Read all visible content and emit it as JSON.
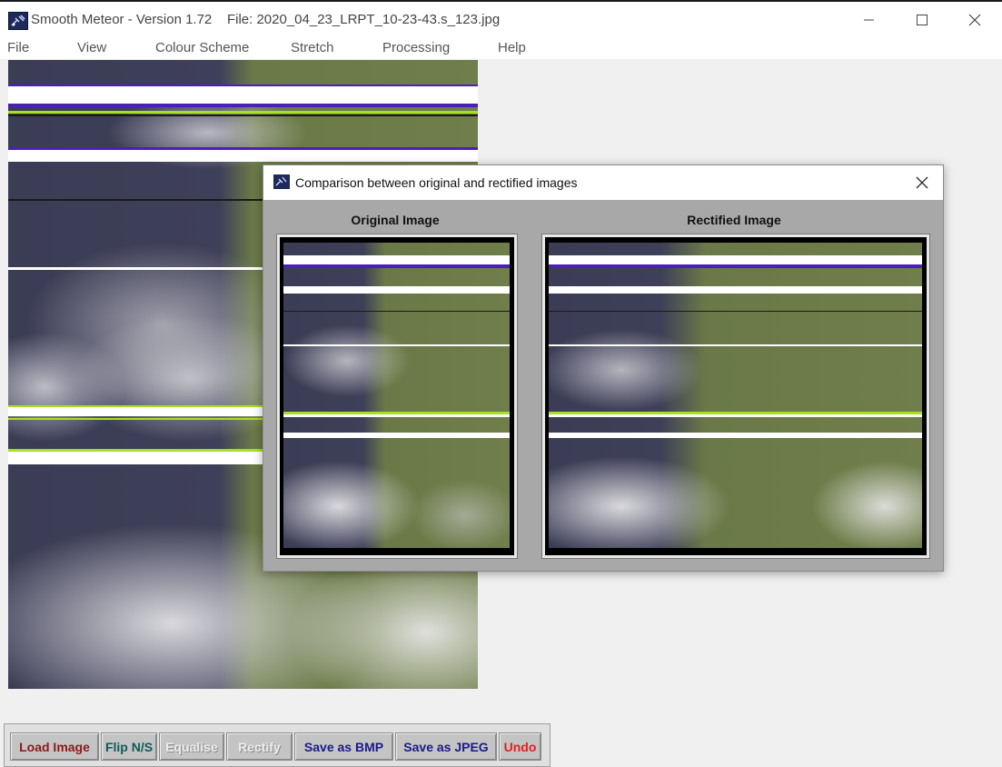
{
  "window": {
    "app_title": "Smooth Meteor - Version 1.72",
    "file_label": "File: 2020_04_23_LRPT_10-23-43.s_123.jpg",
    "icon": "satellite-icon",
    "controls": [
      "minimize-icon",
      "maximize-icon",
      "close-icon"
    ]
  },
  "menu": {
    "items": [
      "File",
      "View",
      "Colour Scheme",
      "Stretch",
      "Processing",
      "Help"
    ]
  },
  "dialog": {
    "title": "Comparison between original and rectified images",
    "original_label": "Original Image",
    "rectified_label": "Rectified Image",
    "icon": "satellite-icon"
  },
  "toolbar": {
    "buttons": [
      {
        "label": "Load Image",
        "color": "#8b1a1a",
        "enabled": true
      },
      {
        "label": "Flip N/S",
        "color": "#0f5a5a",
        "enabled": true
      },
      {
        "label": "Equalise",
        "color": "#ececec",
        "enabled": false
      },
      {
        "label": "Rectify",
        "color": "#ececec",
        "enabled": false
      },
      {
        "label": "Save as BMP",
        "color": "#1a1a8b",
        "enabled": true
      },
      {
        "label": "Save as JPEG",
        "color": "#1a1a8b",
        "enabled": true
      },
      {
        "label": "Undo",
        "color": "#e02020",
        "enabled": true
      }
    ]
  },
  "colors": {
    "land": "#6f7e4a",
    "sea": "#3e3f58",
    "cloud": "#d8d8d8",
    "band_white": "#ffffff",
    "band_violet": "#4a20b8",
    "band_lime": "#a6e020"
  }
}
